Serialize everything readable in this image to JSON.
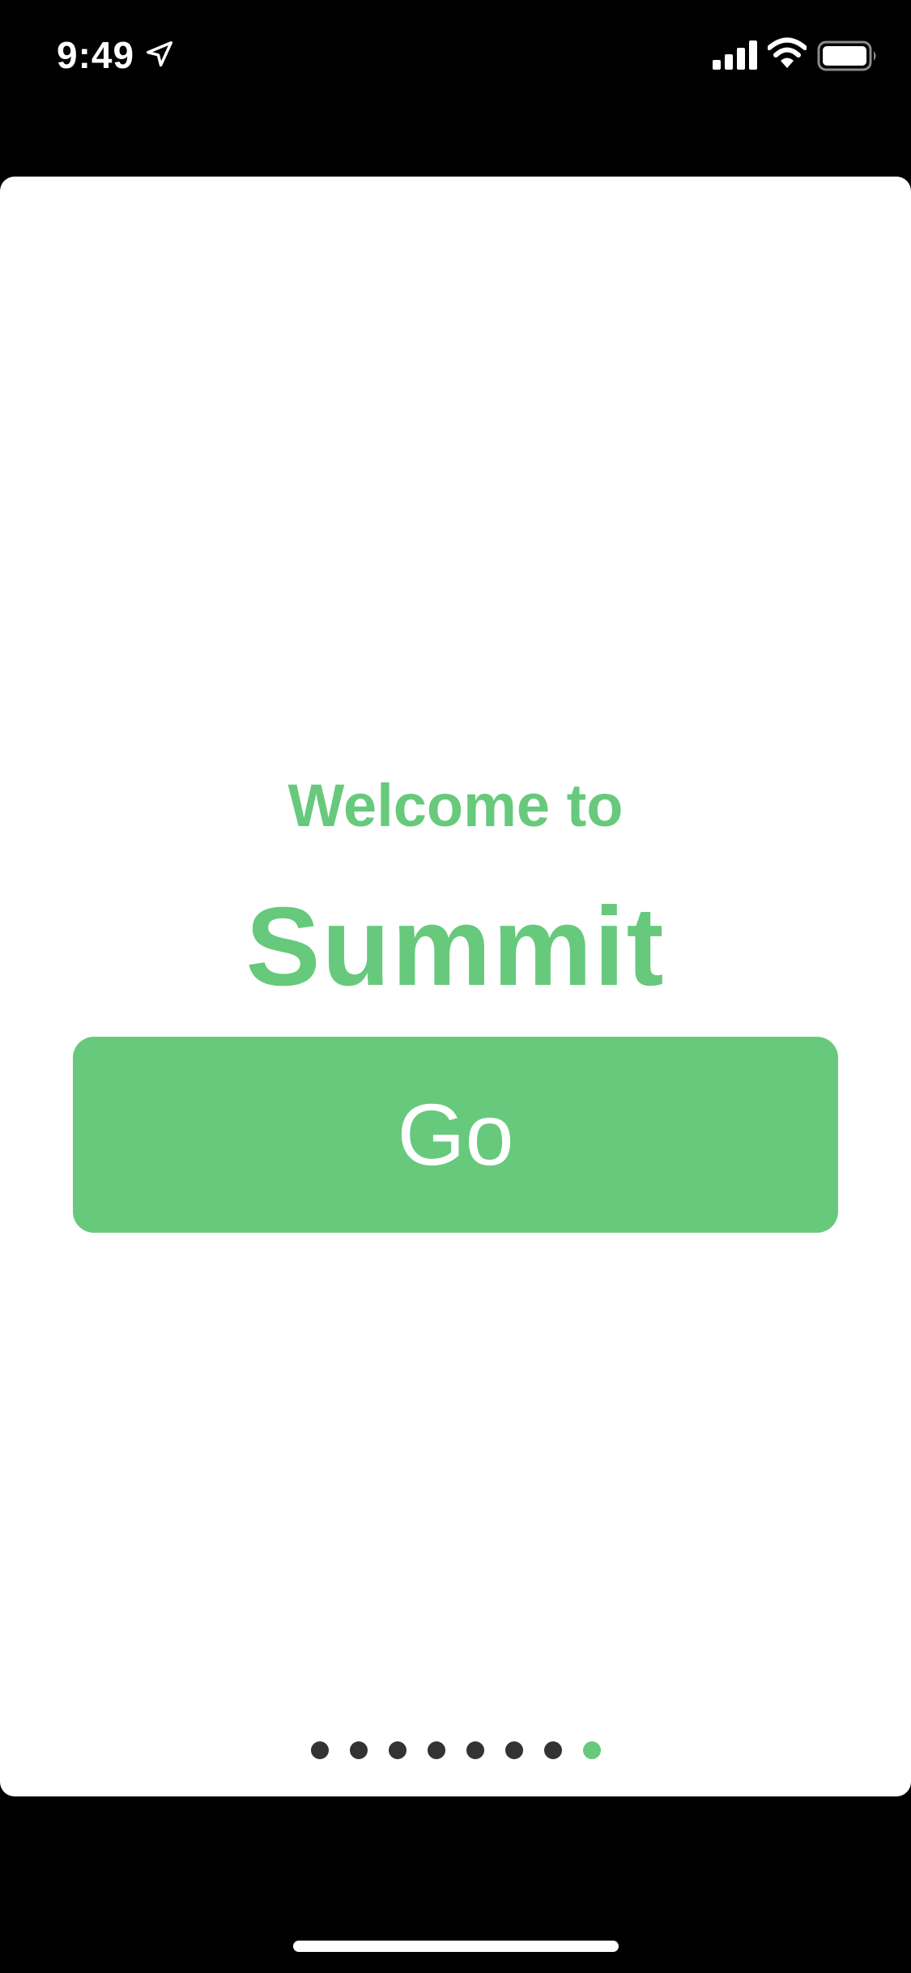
{
  "status_bar": {
    "time": "9:49",
    "icons": [
      "location-arrow-icon",
      "cellular-signal-icon",
      "wifi-icon",
      "battery-icon"
    ]
  },
  "onboarding": {
    "welcome": "Welcome to",
    "app_name": "Summit",
    "go_label": "Go",
    "page_indicator": {
      "total_pages": 8,
      "current_page": 8
    }
  },
  "colors": {
    "accent": "#67c97c",
    "background": "#000000",
    "card": "#ffffff",
    "dot_inactive": "#333333"
  }
}
